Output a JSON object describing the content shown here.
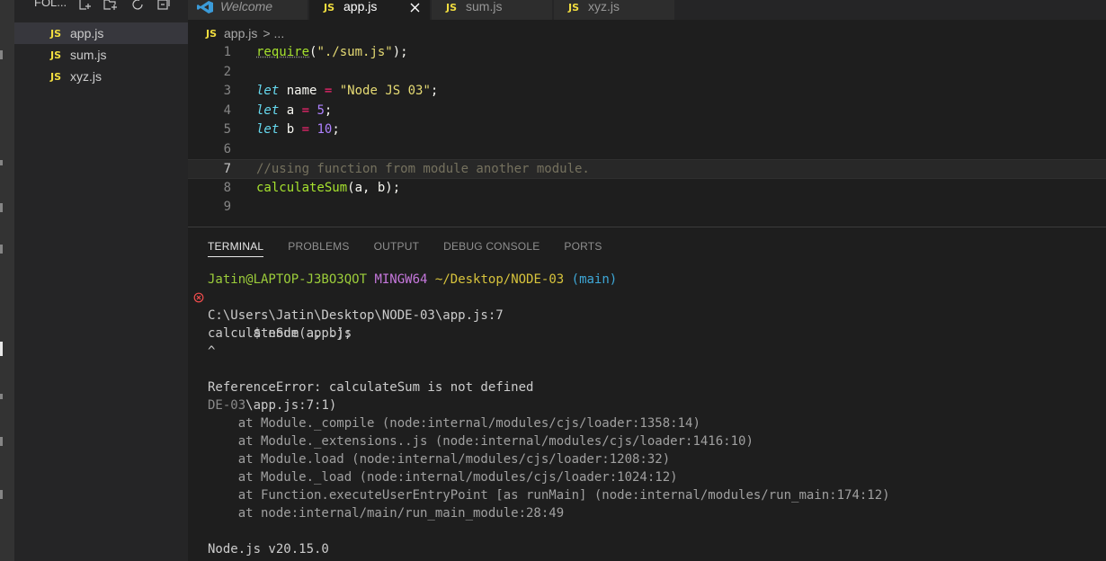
{
  "sidebar": {
    "title": "FOL...",
    "files": [
      {
        "badge": "JS",
        "name": "app.js",
        "selected": true
      },
      {
        "badge": "JS",
        "name": "sum.js",
        "selected": false
      },
      {
        "badge": "JS",
        "name": "xyz.js",
        "selected": false
      }
    ]
  },
  "tabs": [
    {
      "label": "Welcome",
      "icon": "vscode-logo-icon"
    },
    {
      "badge": "JS",
      "label": "app.js",
      "active": true,
      "close": "×"
    },
    {
      "badge": "JS",
      "label": "sum.js"
    },
    {
      "badge": "JS",
      "label": "xyz.js"
    }
  ],
  "breadcrumb": {
    "badge": "JS",
    "file": "app.js",
    "sep": ">",
    "more": "..."
  },
  "editor": {
    "lines": [
      {
        "n": "1",
        "tokens": [
          [
            "fn squiggle",
            "require"
          ],
          [
            "punc",
            "("
          ],
          [
            "str",
            "\"./sum.js\""
          ],
          [
            "punc",
            ");"
          ]
        ]
      },
      {
        "n": "2",
        "tokens": []
      },
      {
        "n": "3",
        "tokens": [
          [
            "kw",
            "let"
          ],
          [
            "plain",
            " name "
          ],
          [
            "op",
            "="
          ],
          [
            "plain",
            " "
          ],
          [
            "str",
            "\"Node JS 03\""
          ],
          [
            "punc",
            ";"
          ]
        ]
      },
      {
        "n": "4",
        "tokens": [
          [
            "kw",
            "let"
          ],
          [
            "plain",
            " a "
          ],
          [
            "op",
            "="
          ],
          [
            "plain",
            " "
          ],
          [
            "num",
            "5"
          ],
          [
            "punc",
            ";"
          ]
        ]
      },
      {
        "n": "5",
        "tokens": [
          [
            "kw",
            "let"
          ],
          [
            "plain",
            " b "
          ],
          [
            "op",
            "="
          ],
          [
            "plain",
            " "
          ],
          [
            "num",
            "10"
          ],
          [
            "punc",
            ";"
          ]
        ]
      },
      {
        "n": "6",
        "tokens": []
      },
      {
        "n": "7",
        "tokens": [
          [
            "cmt",
            "//using function from module another module."
          ]
        ],
        "highlight": true
      },
      {
        "n": "8",
        "tokens": [
          [
            "fn",
            "calculateSum"
          ],
          [
            "punc",
            "(a, b);"
          ]
        ]
      },
      {
        "n": "9",
        "tokens": []
      }
    ]
  },
  "panel": {
    "tabs": [
      {
        "label": "TERMINAL",
        "active": true
      },
      {
        "label": "PROBLEMS"
      },
      {
        "label": "OUTPUT"
      },
      {
        "label": "DEBUG CONSOLE"
      },
      {
        "label": "PORTS"
      }
    ]
  },
  "terminal": {
    "prompt": {
      "user": "Jatin@LAPTOP-J3BO3QOT",
      "env": "MINGW64",
      "path": "~/Desktop/NODE-03",
      "branch": "(main)"
    },
    "command": "$ node app.js",
    "output": [
      "C:\\Users\\Jatin\\Desktop\\NODE-03\\app.js:7",
      "calculateSum(a, b);",
      "^",
      "",
      "ReferenceError: calculateSum is not defined"
    ],
    "trace_prefix_dim": "DE-03",
    "trace_prefix_rest": "\\app.js:7:1)",
    "stack": [
      "    at Module._compile (node:internal/modules/cjs/loader:1358:14)",
      "    at Module._extensions..js (node:internal/modules/cjs/loader:1416:10)",
      "    at Module.load (node:internal/modules/cjs/loader:1208:32)",
      "    at Module._load (node:internal/modules/cjs/loader:1024:12)",
      "    at Function.executeUserEntryPoint [as runMain] (node:internal/modules/run_main:174:12)",
      "    at node:internal/main/run_main_module:28:49"
    ],
    "version": "Node.js v20.15.0"
  },
  "colors": {
    "js_badge": "#f1dd3f",
    "prompt_user": "#9ccd3a",
    "prompt_env": "#c678dd",
    "prompt_path": "#d7c33c",
    "prompt_branch": "#3ea8d8",
    "error_icon": "#f14c4c"
  }
}
